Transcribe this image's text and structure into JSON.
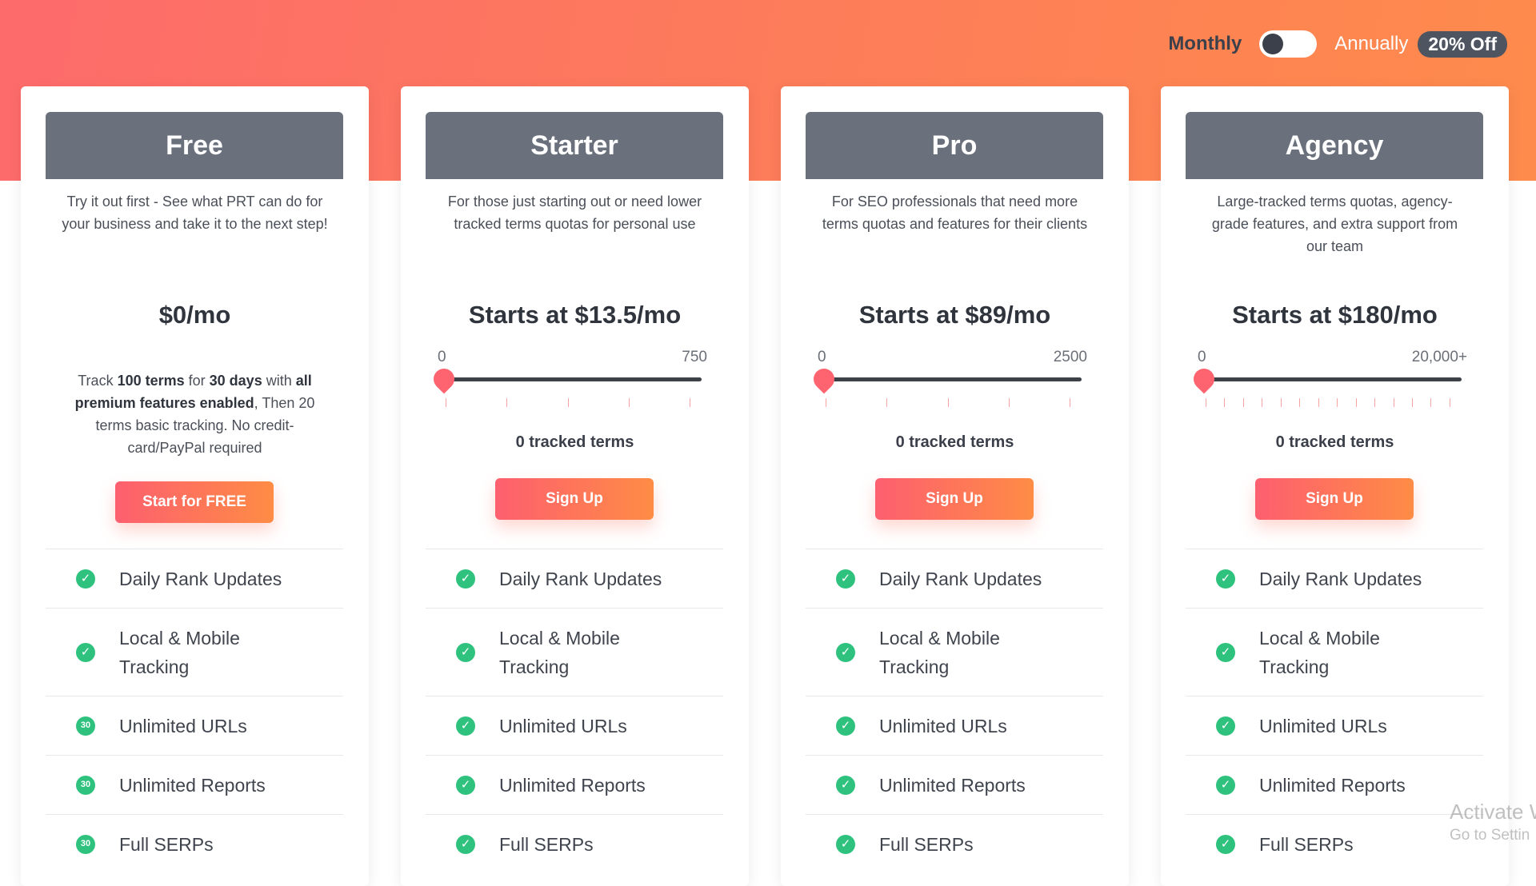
{
  "billing": {
    "monthly_label": "Monthly",
    "annually_label": "Annually",
    "discount_label": "20% Off",
    "selected": "Monthly"
  },
  "colors": {
    "accent_start": "#fd5f6f",
    "accent_end": "#fe8c45",
    "header_gray": "#6b717c",
    "check_green": "#2ec27e"
  },
  "plans": [
    {
      "name": "Free",
      "description": "Try it out first - See what PRT can do for your business and take it to the next step!",
      "price": "$0/mo",
      "note": {
        "t1": "Track ",
        "b1": "100 terms",
        "t2": " for ",
        "b2": "30 days",
        "t3": " with ",
        "b3": "all premium features enabled",
        "t4": ", Then 20 terms basic tracking. No credit-card/PayPal required"
      },
      "cta": "Start for FREE",
      "features": [
        {
          "label": "Daily Rank Updates",
          "icon": "check-icon"
        },
        {
          "label": "Local & Mobile Tracking",
          "icon": "check-icon"
        },
        {
          "label": "Unlimited URLs",
          "icon": "trial-30-icon",
          "icon_text": "30"
        },
        {
          "label": "Unlimited Reports",
          "icon": "trial-30-icon",
          "icon_text": "30"
        },
        {
          "label": "Full SERPs",
          "icon": "trial-30-icon",
          "icon_text": "30"
        }
      ]
    },
    {
      "name": "Starter",
      "description": "For those just starting out or need lower tracked terms quotas for personal use",
      "price": "Starts at $13.5/mo",
      "slider": {
        "min_label": "0",
        "max_label": "750",
        "value": 0,
        "max": 750,
        "tick_count": 5
      },
      "tracked_label": "0 tracked terms",
      "cta": "Sign Up",
      "features": [
        {
          "label": "Daily Rank Updates",
          "icon": "check-icon"
        },
        {
          "label": "Local & Mobile Tracking",
          "icon": "check-icon"
        },
        {
          "label": "Unlimited URLs",
          "icon": "check-icon"
        },
        {
          "label": "Unlimited Reports",
          "icon": "check-icon"
        },
        {
          "label": "Full SERPs",
          "icon": "check-icon"
        }
      ]
    },
    {
      "name": "Pro",
      "description": "For SEO professionals that need more terms quotas and features for their clients",
      "price": "Starts at $89/mo",
      "slider": {
        "min_label": "0",
        "max_label": "2500",
        "value": 0,
        "max": 2500,
        "tick_count": 5
      },
      "tracked_label": "0 tracked terms",
      "cta": "Sign Up",
      "features": [
        {
          "label": "Daily Rank Updates",
          "icon": "check-icon"
        },
        {
          "label": "Local & Mobile Tracking",
          "icon": "check-icon"
        },
        {
          "label": "Unlimited URLs",
          "icon": "check-icon"
        },
        {
          "label": "Unlimited Reports",
          "icon": "check-icon"
        },
        {
          "label": "Full SERPs",
          "icon": "check-icon"
        }
      ]
    },
    {
      "name": "Agency",
      "description": "Large-tracked terms quotas, agency-grade features, and extra support from our team",
      "price": "Starts at $180/mo",
      "slider": {
        "min_label": "0",
        "max_label": "20,000+",
        "value": 0,
        "max": 20000,
        "tick_count": 14
      },
      "tracked_label": "0 tracked terms",
      "cta": "Sign Up",
      "features": [
        {
          "label": "Daily Rank Updates",
          "icon": "check-icon"
        },
        {
          "label": "Local & Mobile Tracking",
          "icon": "check-icon"
        },
        {
          "label": "Unlimited URLs",
          "icon": "check-icon"
        },
        {
          "label": "Unlimited Reports",
          "icon": "check-icon"
        },
        {
          "label": "Full SERPs",
          "icon": "check-icon"
        }
      ]
    }
  ],
  "watermark": {
    "title": "Activate W",
    "subtitle": "Go to Settin"
  }
}
